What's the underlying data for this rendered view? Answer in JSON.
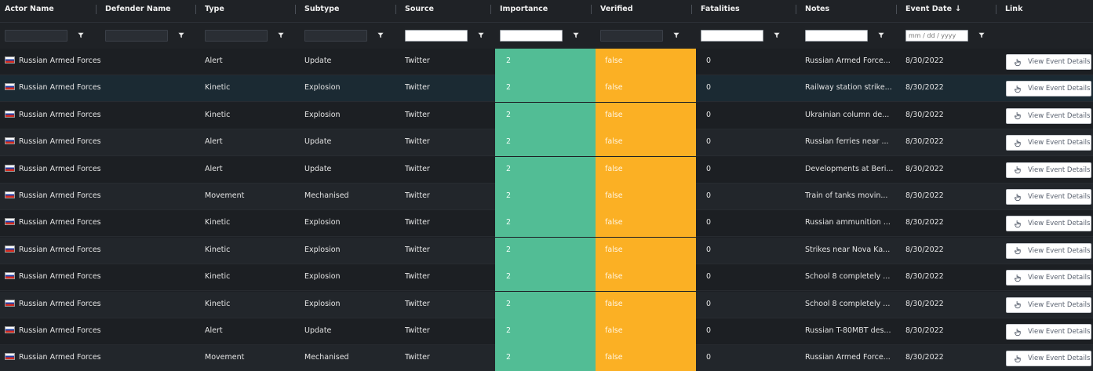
{
  "columns": [
    {
      "key": "actor",
      "label": "Actor Name"
    },
    {
      "key": "defender",
      "label": "Defender Name"
    },
    {
      "key": "type",
      "label": "Type"
    },
    {
      "key": "subtype",
      "label": "Subtype"
    },
    {
      "key": "source",
      "label": "Source"
    },
    {
      "key": "importance",
      "label": "Importance"
    },
    {
      "key": "verified",
      "label": "Verified"
    },
    {
      "key": "fatalities",
      "label": "Fatalities"
    },
    {
      "key": "notes",
      "label": "Notes"
    },
    {
      "key": "event_date",
      "label": "Event Date"
    },
    {
      "key": "link",
      "label": "Link"
    }
  ],
  "sort": {
    "column": "event_date",
    "direction": "descending",
    "icon": "arrow-down-icon"
  },
  "filters": {
    "event_date_placeholder": "mm / dd / yyyy",
    "filter_icon": "filter-icon"
  },
  "colors": {
    "importance_bg": "#52bd95",
    "verified_bg": "#fbb024",
    "background": "#1d2025",
    "selected_row": "#1b2a33"
  },
  "link_button_label": "View Event Details",
  "link_button_icon": "hand-pointer-icon",
  "rows": [
    {
      "actor": "Russian Armed Forces",
      "defender": "",
      "type": "Alert",
      "subtype": "Update",
      "source": "Twitter",
      "importance": "2",
      "verified": "false",
      "fatalities": "0",
      "notes": "Russian Armed Force...",
      "event_date": "8/30/2022",
      "flag_icon": "russia-flag-icon"
    },
    {
      "actor": "Russian Armed Forces",
      "defender": "",
      "type": "Kinetic",
      "subtype": "Explosion",
      "source": "Twitter",
      "importance": "2",
      "verified": "false",
      "fatalities": "0",
      "notes": "Railway station strike...",
      "event_date": "8/30/2022",
      "flag_icon": "russia-flag-icon",
      "selected": true
    },
    {
      "actor": "Russian Armed Forces",
      "defender": "",
      "type": "Kinetic",
      "subtype": "Explosion",
      "source": "Twitter",
      "importance": "2",
      "verified": "false",
      "fatalities": "0",
      "notes": "Ukrainian column de...",
      "event_date": "8/30/2022",
      "flag_icon": "russia-flag-icon"
    },
    {
      "actor": "Russian Armed Forces",
      "defender": "",
      "type": "Alert",
      "subtype": "Update",
      "source": "Twitter",
      "importance": "2",
      "verified": "false",
      "fatalities": "0",
      "notes": "Russian ferries near ...",
      "event_date": "8/30/2022",
      "flag_icon": "russia-flag-icon"
    },
    {
      "actor": "Russian Armed Forces",
      "defender": "",
      "type": "Alert",
      "subtype": "Update",
      "source": "Twitter",
      "importance": "2",
      "verified": "false",
      "fatalities": "0",
      "notes": "Developments at Beri...",
      "event_date": "8/30/2022",
      "flag_icon": "russia-flag-icon"
    },
    {
      "actor": "Russian Armed Forces",
      "defender": "",
      "type": "Movement",
      "subtype": "Mechanised",
      "source": "Twitter",
      "importance": "2",
      "verified": "false",
      "fatalities": "0",
      "notes": "Train of tanks movin...",
      "event_date": "8/30/2022",
      "flag_icon": "russia-flag-icon"
    },
    {
      "actor": "Russian Armed Forces",
      "defender": "",
      "type": "Kinetic",
      "subtype": "Explosion",
      "source": "Twitter",
      "importance": "2",
      "verified": "false",
      "fatalities": "0",
      "notes": "Russian ammunition ...",
      "event_date": "8/30/2022",
      "flag_icon": "russia-flag-icon"
    },
    {
      "actor": "Russian Armed Forces",
      "defender": "",
      "type": "Kinetic",
      "subtype": "Explosion",
      "source": "Twitter",
      "importance": "2",
      "verified": "false",
      "fatalities": "0",
      "notes": "Strikes near Nova Ka...",
      "event_date": "8/30/2022",
      "flag_icon": "russia-flag-icon"
    },
    {
      "actor": "Russian Armed Forces",
      "defender": "",
      "type": "Kinetic",
      "subtype": "Explosion",
      "source": "Twitter",
      "importance": "2",
      "verified": "false",
      "fatalities": "0",
      "notes": "School 8 completely ...",
      "event_date": "8/30/2022",
      "flag_icon": "russia-flag-icon"
    },
    {
      "actor": "Russian Armed Forces",
      "defender": "",
      "type": "Kinetic",
      "subtype": "Explosion",
      "source": "Twitter",
      "importance": "2",
      "verified": "false",
      "fatalities": "0",
      "notes": "School 8 completely ...",
      "event_date": "8/30/2022",
      "flag_icon": "russia-flag-icon"
    },
    {
      "actor": "Russian Armed Forces",
      "defender": "",
      "type": "Alert",
      "subtype": "Update",
      "source": "Twitter",
      "importance": "2",
      "verified": "false",
      "fatalities": "0",
      "notes": "Russian T-80MBT des...",
      "event_date": "8/30/2022",
      "flag_icon": "russia-flag-icon"
    },
    {
      "actor": "Russian Armed Forces",
      "defender": "",
      "type": "Movement",
      "subtype": "Mechanised",
      "source": "Twitter",
      "importance": "2",
      "verified": "false",
      "fatalities": "0",
      "notes": "Russian Armed Force...",
      "event_date": "8/30/2022",
      "flag_icon": "russia-flag-icon"
    }
  ]
}
